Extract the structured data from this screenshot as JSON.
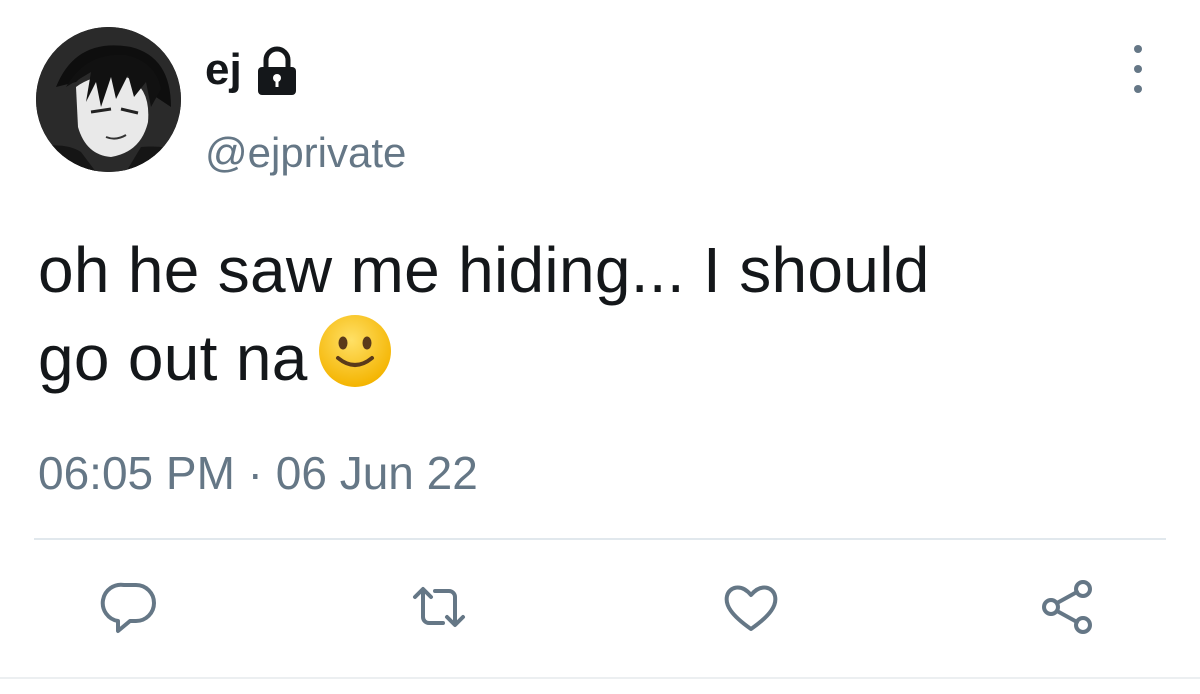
{
  "tweet": {
    "display_name": "ej",
    "handle": "@ejprivate",
    "text_line1": "oh he saw me hiding... I should",
    "text_line2": "go out na",
    "timestamp": "06:05 PM · 06 Jun 22",
    "protected": true
  },
  "icons": {
    "lock": "lock-icon",
    "more": "more-vertical-icon",
    "reply": "reply-icon",
    "retweet": "retweet-icon",
    "like": "heart-icon",
    "share": "share-icon",
    "emoji": "slightly-smiling-face-emoji"
  },
  "colors": {
    "text": "#14171a",
    "secondary": "#657786",
    "divider": "#e1e8ed",
    "emoji": "#f7c02b"
  }
}
